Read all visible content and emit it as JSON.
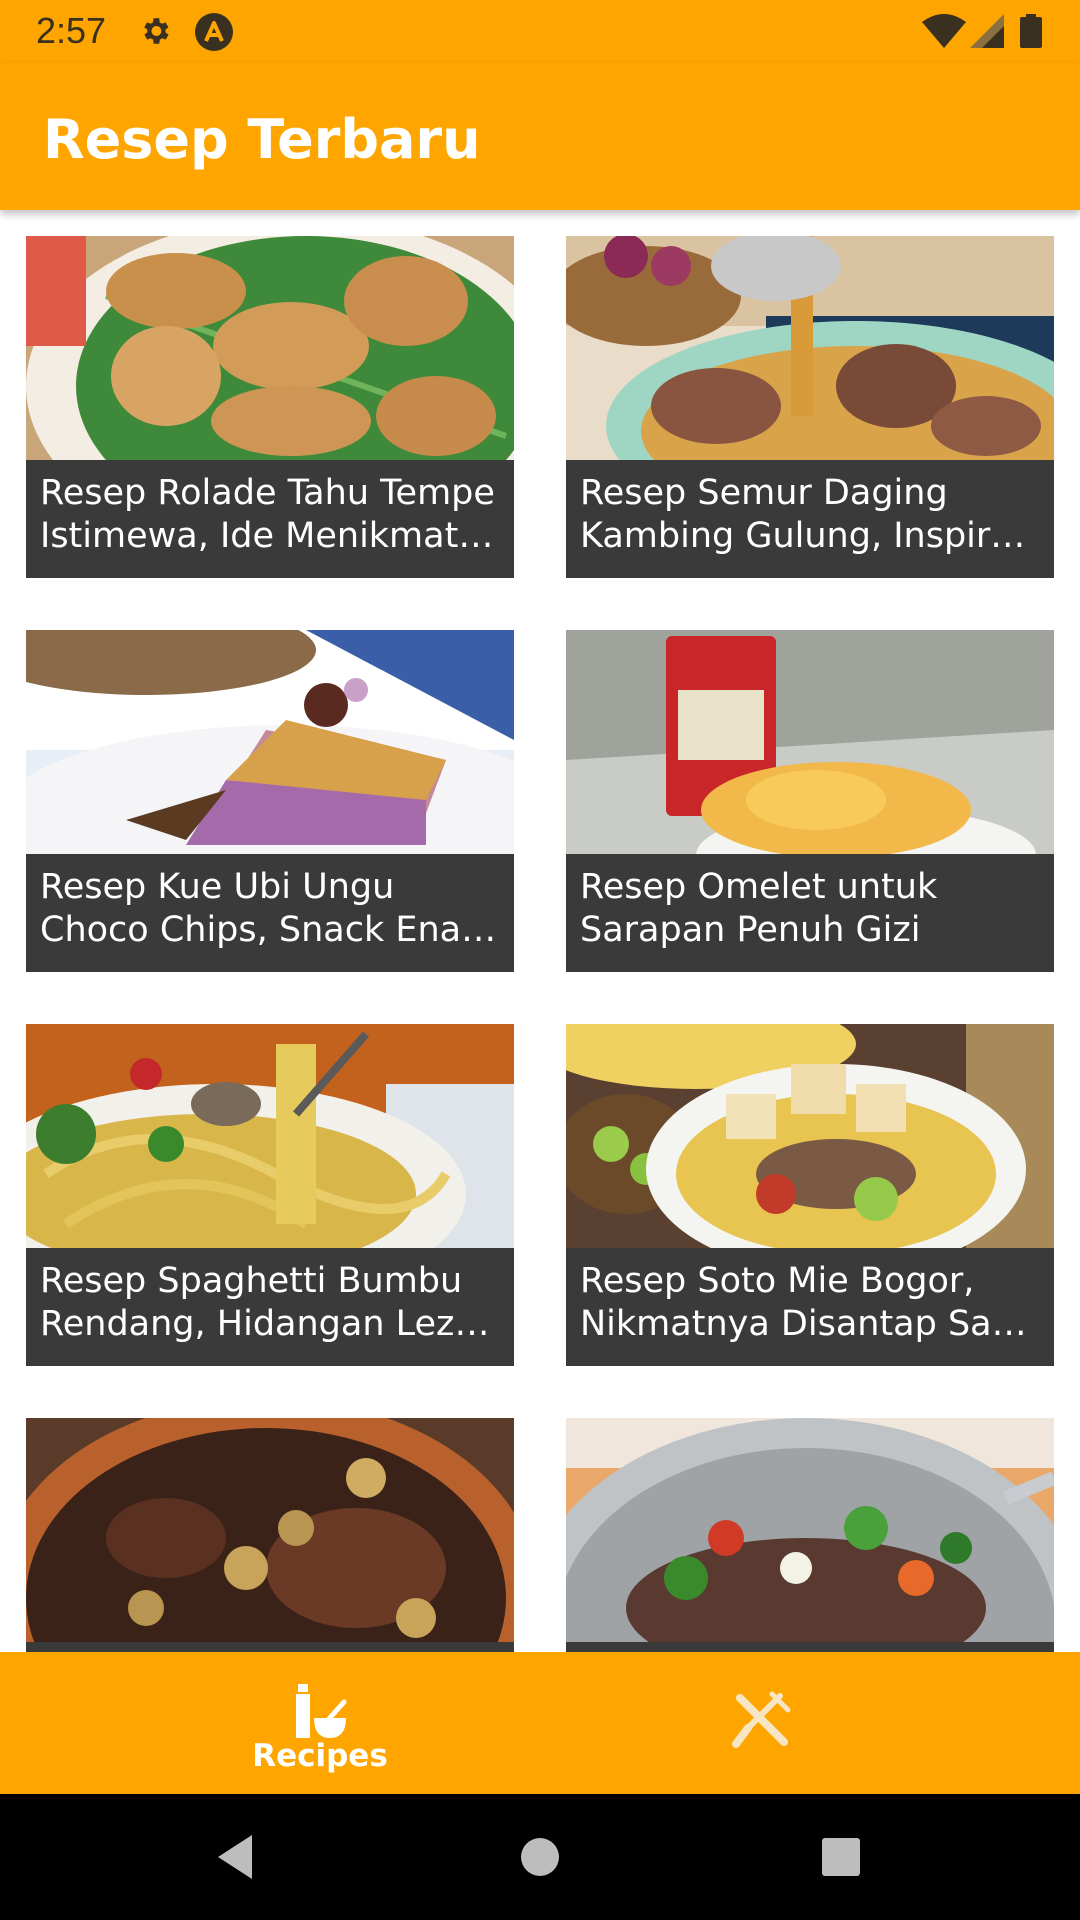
{
  "status_bar": {
    "time": "2:57",
    "icons": [
      "gear-icon",
      "app-notification-icon",
      "wifi-icon",
      "signal-icon",
      "battery-icon"
    ]
  },
  "app_bar": {
    "title": "Resep Terbaru"
  },
  "recipes": [
    {
      "title": "Resep Rolade Tahu Tempe Istimewa, Ide Menikmati T...",
      "image": "rolade-photo"
    },
    {
      "title": "Resep Semur Daging Kambing Gulung, Inspirasi ...",
      "image": "semur-photo"
    },
    {
      "title": "Resep Kue Ubi Ungu Choco Chips, Snack Enak dan Ant...",
      "image": "kue-ubi-photo"
    },
    {
      "title": "Resep Omelet untuk Sarapan Penuh Gizi",
      "image": "omelet-photo"
    },
    {
      "title": "Resep Spaghetti Bumbu Rendang, Hidangan Lezat ...",
      "image": "spaghetti-photo"
    },
    {
      "title": "Resep Soto Mie Bogor, Nikmatnya Disantap Saat ...",
      "image": "soto-mie-photo"
    },
    {
      "title": "",
      "image": "chicken-stew-photo"
    },
    {
      "title": "",
      "image": "stir-fry-photo"
    }
  ],
  "bottom_nav": {
    "items": [
      {
        "label": "Recipes",
        "icon": "recipes-icon",
        "active": true
      },
      {
        "label": "",
        "icon": "utensils-icon",
        "active": false
      }
    ]
  },
  "colors": {
    "accent": "#FFA500",
    "card_caption_bg": "#3a3a3a",
    "text_on_accent": "#ffffff"
  }
}
